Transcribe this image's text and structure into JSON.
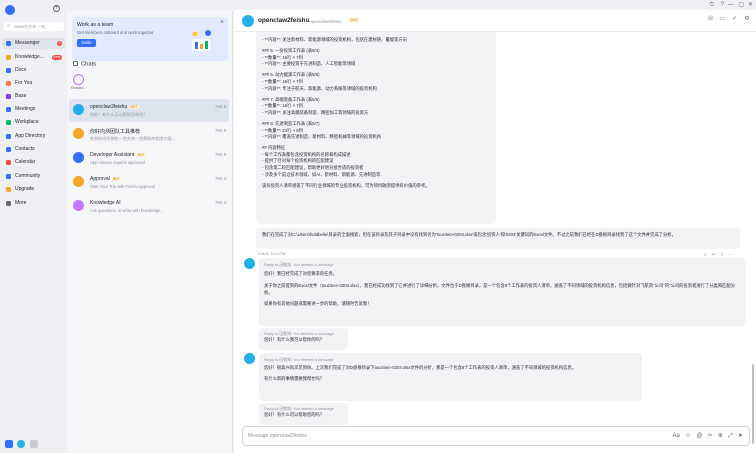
{
  "window": {
    "controls": [
      "⏱",
      "?",
      "—",
      "▢",
      "✕"
    ]
  },
  "sidebar": {
    "search_placeholder": "Search (Ctrl + K)",
    "items": [
      {
        "label": "Messenger",
        "badge": "1",
        "color": "#3370ff",
        "active": true
      },
      {
        "label": "Knowledge...",
        "badge": "New",
        "color": "#f5a52b"
      },
      {
        "label": "Docs",
        "color": "#3370ff"
      },
      {
        "label": "For You",
        "color": "#ff7a45"
      },
      {
        "label": "Base",
        "color": "#7f3bf5"
      },
      {
        "label": "Meetings",
        "color": "#3370ff"
      },
      {
        "label": "Workplace",
        "color": "#00b96b"
      },
      {
        "label": "App Directory",
        "color": "#3370ff"
      },
      {
        "label": "Contacts",
        "color": "#3370ff"
      },
      {
        "label": "Calendar",
        "color": "#f54a45"
      },
      {
        "label": "Community",
        "color": "#3370ff"
      },
      {
        "label": "Upgrade",
        "color": "#f5a52b"
      },
      {
        "label": "More",
        "color": "#646a73"
      }
    ]
  },
  "chatlist": {
    "team_card": {
      "title": "Work as a team",
      "subtitle": "Get members onboard and work together",
      "invite_label": "Invite"
    },
    "chats_header": "Chats",
    "recent_label": "Knowled...",
    "items": [
      {
        "name": "openclaw2feishu",
        "bot": "BOT",
        "preview": "你好！有什么可以帮助您的吗？",
        "date": "Feb 5",
        "color": "#21b0e8",
        "active": true
      },
      {
        "name": "你好内测团队工具推荐",
        "bot": "",
        "preview": "收到你问的那些一些交流一些帮助的相关内容...",
        "date": "Feb 5",
        "color": "#f5a52b"
      },
      {
        "name": "Developer Assistant",
        "bot": "BOT",
        "preview": "App release request approved",
        "date": "Feb 5",
        "color": "#3370ff"
      },
      {
        "name": "Approval",
        "bot": "BOT",
        "preview": "Start Your Trip with Feishu Approval",
        "date": "Feb 4",
        "color": "#f5a52b"
      },
      {
        "name": "Knowledge AI",
        "bot": "",
        "preview": "Ask questions, or write with knowledge...",
        "date": "Feb 4",
        "color": "#c476ff"
      }
    ]
  },
  "conversation": {
    "title": "openclaw2feishu",
    "subtitle": "openclaw2feishu",
    "bot_tag": "BOT",
    "header_icons": [
      "☏",
      "▭",
      "✓",
      "⚙"
    ],
    "top_bubble_lines": [
      "- **内容**: 关注新材料、新能源领域的投资机构，包括在建材链、量能等方向",
      "",
      "### 5. 一份投资工作表 (表5/4)",
      "- **数量**: 16行 × 7列",
      "- **内容**: 主要投资于先进制造、人工智能等领域",
      "",
      "### 6. 动力能源工作表 (表5/5)",
      "- **数量**: 16行 × 7列",
      "- **内容**: 专注于航天、新能源、动力系统等领域的投资机构",
      "",
      "### 7. 高端装备工作表 (表5/6)",
      "- **数量**: 16行 × 7列",
      "- **内容**: 关注高端装备制造、精密加工等领域的投资方",
      "",
      "### 8. 先进制造工作表 (表5/7)",
      "- **数量**: 23行 × 8列",
      "- **内容**: 覆盖先进制造、新材料、精密机械等领域的投资机构",
      "",
      "## 内容特征",
      "- 每个工作表都包含投资机构的名称和构成描述",
      "- 提供了针对每个投资机构的匹配建议",
      "- 包含第二轮匹配建议，帮助更好地对接合适的投资者",
      "- 涉及多个前沿技术领域，如AI、新材料、新能源、先进制造等",
      "",
      "该份投资人清单涵盖了不同行业领域的专业投资机构，可为项目融资提供有价值的参考。"
    ],
    "user_note": "我们在完成了对C:\\Users\\holdbelie\\目录的全面搜索，但在该目录及其子目录中没有找到名为'touzinen-0204.xlsx'或包含'投资人'和'0204'关键词的Excel文件。不过之前我们已经在D盘根目录找到了这个文件并完成了分析。",
    "time1": "Feb 5, 3:31 PM",
    "msg1": {
      "quote": "Reply to 田数知: You deleted a message",
      "lines": [
        "您好！我已经完成了对您要求的任务。",
        "",
        "关于你之前提到的Excel文件（touzinen-0204.xlsx），我已经成功找到了它并进行了详细分析。文件位于D盘根目录，是一个包含8个工作表的投资人清单，涵盖了不同领域的投资机构信息，包括微针对飞航资\"公司\"的\"公司的投资者进行了分类和匹配分析。",
        "",
        "如果你有其他问题或需要进一步的帮助，请随时告诉我！"
      ]
    },
    "msg2": {
      "quote": "Reply to 田数知: You deleted a message",
      "line": "您好！有什么我可以帮你的吗？"
    },
    "msg3": {
      "quote": "Reply to 田数知: You deleted a message",
      "lines": [
        "您好！很高兴再次见到你。上次我们完成了对D盘根目录下touzinen-0204.xlsx文件的分析，那是一个包含8个工作表的投资人清单，涵盖了不同领域的投资机构信息。",
        "",
        "有什么新的事情需要我帮忙吗？"
      ]
    },
    "msg4": {
      "quote": "Reply to 田数知: You deleted a message",
      "line": "您好！有什么可以帮助您的吗？"
    },
    "msg_tools": [
      "☺",
      "↩",
      "⇧",
      "⋯"
    ],
    "composer_placeholder": "Message openclaw2feishu",
    "composer_tools": [
      "Aa",
      "☺",
      "@",
      "✂",
      "⊕",
      "⤢",
      "➤"
    ]
  }
}
